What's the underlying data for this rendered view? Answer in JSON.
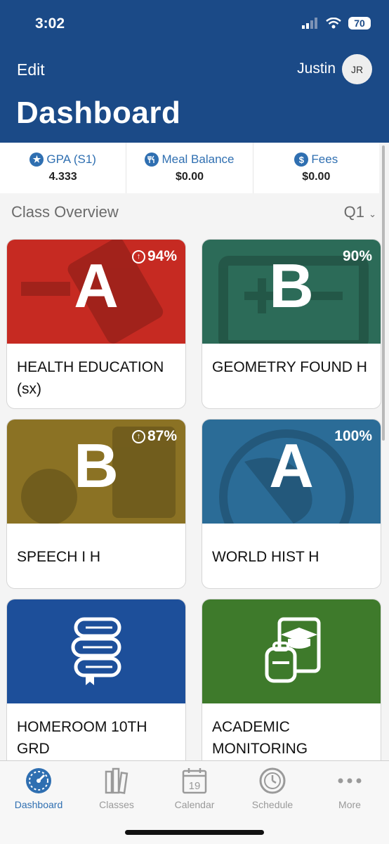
{
  "status": {
    "time": "3:02",
    "battery": "70"
  },
  "header": {
    "edit_label": "Edit",
    "username": "Justin",
    "avatar_initials": "JR",
    "title": "Dashboard"
  },
  "stats": [
    {
      "label": "GPA (S1)",
      "value": "4.333",
      "icon": "star-icon"
    },
    {
      "label": "Meal Balance",
      "value": "$0.00",
      "icon": "utensils-icon"
    },
    {
      "label": "Fees",
      "value": "$0.00",
      "icon": "dollar-icon"
    }
  ],
  "overview": {
    "title": "Class Overview",
    "quarter": "Q1"
  },
  "classes": [
    {
      "name": "HEALTH EDUCATION (sx)",
      "grade": "A",
      "percent": "94%",
      "trend": "up",
      "color": "#c62a22"
    },
    {
      "name": "GEOMETRY FOUND H",
      "grade": "B",
      "percent": "90%",
      "color": "#2c6b58"
    },
    {
      "name": "SPEECH I H",
      "grade": "B",
      "percent": "87%",
      "trend": "up",
      "color": "#8b7224"
    },
    {
      "name": "WORLD HIST H",
      "grade": "A",
      "percent": "100%",
      "color": "#2b6c97"
    },
    {
      "name": "HOMEROOM 10TH GRD",
      "icon": "books-icon",
      "color": "#1d4f9a"
    },
    {
      "name": "ACADEMIC MONITORING",
      "icon": "graduation-backpack-icon",
      "color": "#3e7a2b"
    }
  ],
  "tabs": [
    {
      "label": "Dashboard",
      "active": true
    },
    {
      "label": "Classes"
    },
    {
      "label": "Calendar",
      "calendar_day": "19"
    },
    {
      "label": "Schedule"
    },
    {
      "label": "More"
    }
  ]
}
